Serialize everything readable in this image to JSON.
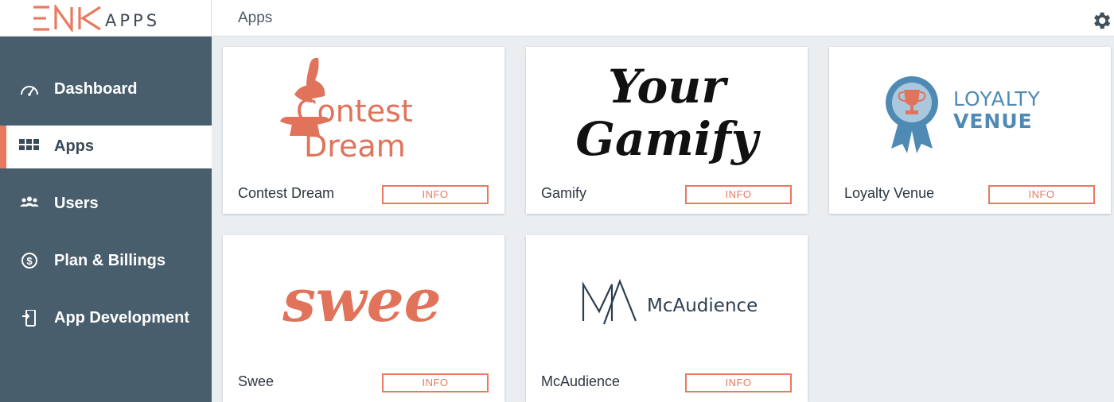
{
  "header": {
    "brand": {
      "mark": "ENK",
      "suffix": "APPS"
    },
    "title": "Apps",
    "settings_icon": "gear-icon"
  },
  "sidebar": {
    "items": [
      {
        "label": "Dashboard",
        "icon": "gauge-icon",
        "active": false
      },
      {
        "label": "Apps",
        "icon": "grid-icon",
        "active": true
      },
      {
        "label": "Users",
        "icon": "users-icon",
        "active": false
      },
      {
        "label": "Plan & Billings",
        "icon": "dollar-icon",
        "active": false
      },
      {
        "label": "App Development",
        "icon": "mobile-dev-icon",
        "active": false
      }
    ]
  },
  "apps": [
    {
      "name": "Contest Dream",
      "logo_lines": [
        "Contest",
        "Dream"
      ],
      "button": "INFO"
    },
    {
      "name": "Gamify",
      "logo_lines": [
        "Your",
        "Gamify"
      ],
      "button": "INFO"
    },
    {
      "name": "Loyalty Venue",
      "logo_lines": [
        "LOYALTY",
        "VENUE"
      ],
      "button": "INFO"
    },
    {
      "name": "Swee",
      "logo_lines": [
        "swee"
      ],
      "button": "INFO"
    },
    {
      "name": "McAudience",
      "logo_lines": [
        "McAudience"
      ],
      "button": "INFO"
    }
  ],
  "colors": {
    "accent": "#e97a5f",
    "sidebar": "#495e6d",
    "background": "#eaeef1",
    "loyalty_blue": "#4f8ab4",
    "mcaudience_navy": "#2c3e50"
  }
}
